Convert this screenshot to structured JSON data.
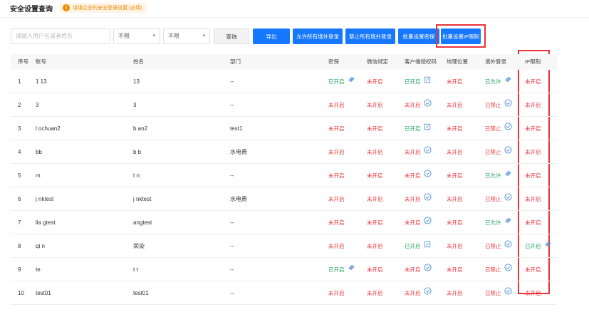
{
  "header": {
    "title": "安全设置查询",
    "notice": "请填企业的安全登录设置 (必填)",
    "notice_icon": "warning-icon",
    "accent": "#f08a00"
  },
  "toolbar": {
    "search_placeholder": "请输入用户名或者姓名",
    "filter1": "不限",
    "filter2": "不限",
    "query": "查询",
    "export": "导出",
    "allow_all_overseas": "允许所有境外登录",
    "forbid_all_overseas": "禁止所有境外登录",
    "batch_protect": "批量设置密保",
    "batch_ip": "批量设置IP限制"
  },
  "columns": {
    "index": "序号",
    "account": "账号",
    "name": "姓名",
    "dept": "部门",
    "protect": "密保",
    "wechat": "微信绑定",
    "client": "客户端授权码",
    "location": "地理位置",
    "overseas": "境外登录",
    "ip": "IP限制"
  },
  "colors": {
    "primary": "#1677ff",
    "red": "#e8333a",
    "green": "#21a35f"
  },
  "rows": [
    {
      "index": "1",
      "account": "1  13",
      "name": "  13",
      "dept": "--",
      "protect": "已开启",
      "wechat": "未开启",
      "client": "已开启",
      "location": "未开启",
      "overseas": "已允许",
      "ip": "未开启"
    },
    {
      "index": "2",
      "account": "3",
      "name": "3",
      "dept": "--",
      "protect": "未开启",
      "wechat": "未开启",
      "client": "未开启",
      "location": "未开启",
      "overseas": "已禁止",
      "ip": "未开启"
    },
    {
      "index": "3",
      "account": "l  ochuan2",
      "name": "b      an2",
      "dept": "test1",
      "protect": "未开启",
      "wechat": "未开启",
      "client": "已开启",
      "location": "未开启",
      "overseas": "已禁止",
      "ip": "未开启"
    },
    {
      "index": "4",
      "account": "  bb",
      "name": "b  b",
      "dept": "水电费",
      "protect": "未开启",
      "wechat": "未开启",
      "client": "未开启",
      "location": "未开启",
      "overseas": "已禁止",
      "ip": "未开启"
    },
    {
      "index": "5",
      "account": "  m",
      "name": "t  n",
      "dept": "--",
      "protect": "未开启",
      "wechat": "未开启",
      "client": "未开启",
      "location": "未开启",
      "overseas": "已允许",
      "ip": "未开启"
    },
    {
      "index": "6",
      "account": "j  nktest",
      "name": "j  nktest",
      "dept": "水电费",
      "protect": "未开启",
      "wechat": "未开启",
      "client": "未开启",
      "location": "未开启",
      "overseas": "已禁止",
      "ip": "未开启"
    },
    {
      "index": "7",
      "account": "lia  gtest",
      "name": "  angtest",
      "dept": "--",
      "protect": "未开启",
      "wechat": "未开启",
      "client": "未开启",
      "location": "未开启",
      "overseas": "已允许",
      "ip": "未开启"
    },
    {
      "index": "8",
      "account": "qi  n",
      "name": "荣染",
      "dept": "--",
      "protect": "未开启",
      "wechat": "未开启",
      "client": "已开启",
      "location": "未开启",
      "overseas": "已禁止",
      "ip": "已开启"
    },
    {
      "index": "9",
      "account": "te  ",
      "name": "t  t",
      "dept": "--",
      "protect": "已开启",
      "wechat": "未开启",
      "client": "未开启",
      "location": "未开启",
      "overseas": "已禁止",
      "ip": "未开启"
    },
    {
      "index": "10",
      "account": "test01",
      "name": "test01",
      "dept": "--",
      "protect": "未开启",
      "wechat": "未开启",
      "client": "未开启",
      "location": "未开启",
      "overseas": "已禁止",
      "ip": "未开启"
    }
  ]
}
